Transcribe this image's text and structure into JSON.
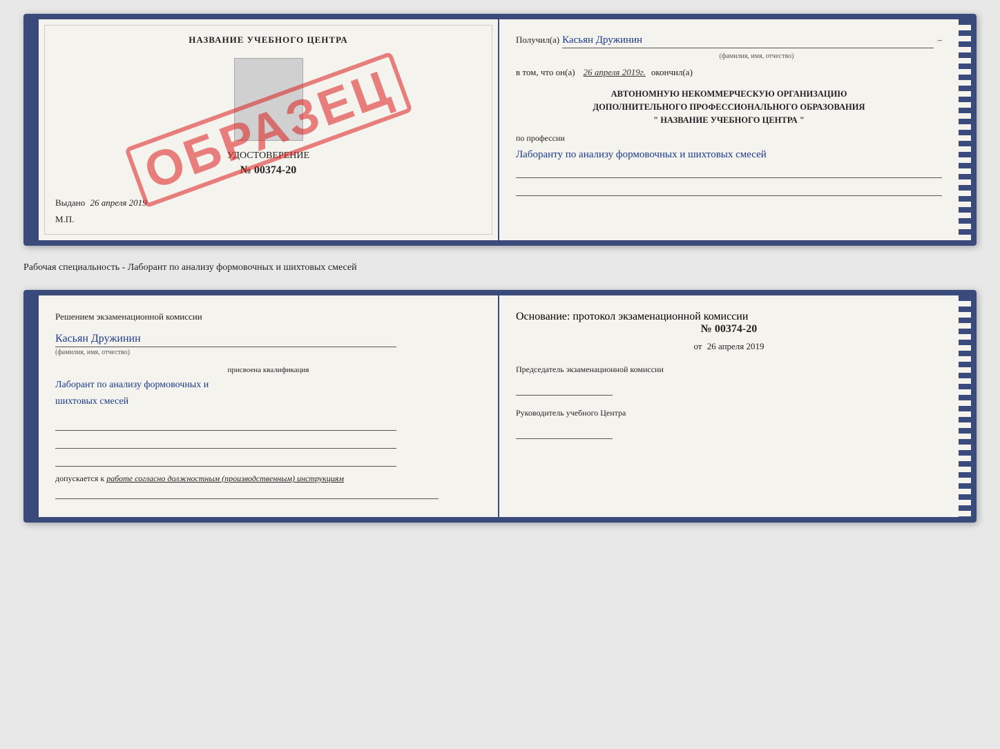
{
  "page": {
    "background": "#e8e8e8"
  },
  "top_booklet": {
    "left": {
      "title": "НАЗВАНИЕ УЧЕБНОГО ЦЕНТРА",
      "stamp": "ОБРАЗЕЦ",
      "udostoverenie_label": "УДОСТОВЕРЕНИЕ",
      "number": "№ 00374-20",
      "vydano_label": "Выдано",
      "vydano_date": "26 апреля 2019",
      "mp": "М.П."
    },
    "right": {
      "poluchil_label": "Получил(а)",
      "poluchil_name": "Касьян Дружинин",
      "fio_sub": "(фамилия, имя, отчество)",
      "vtom_label": "в том, что он(а)",
      "vtom_date": "26 апреля 2019г.",
      "okonchil_label": "окончил(а)",
      "org_line1": "АВТОНОМНУЮ НЕКОММЕРЧЕСКУЮ ОРГАНИЗАЦИЮ",
      "org_line2": "ДОПОЛНИТЕЛЬНОГО ПРОФЕССИОНАЛЬНОГО ОБРАЗОВАНИЯ",
      "org_line3": "\"  НАЗВАНИЕ УЧЕБНОГО ЦЕНТРА  \"",
      "po_professii_label": "по профессии",
      "profession_text": "Лаборанту по анализу формовочных и шихтовых смесей"
    }
  },
  "specialty_text": "Рабочая специальность - Лаборант по анализу формовочных и шихтовых смесей",
  "bottom_booklet": {
    "left": {
      "section_title": "Решением экзаменационной комиссии",
      "person_name": "Касьян Дружинин",
      "fio_sub": "(фамилия, имя, отчество)",
      "qualification_label": "присвоена квалификация",
      "qualification_text": "Лаборант по анализу формовочных и\nшихтовых смесей",
      "dopuskaetsya_label": "допускается к",
      "dopuskaetsya_text": "работе согласно должностным (производственным) инструкциям"
    },
    "right": {
      "osnovanie_label": "Основание: протокол экзаменационной комиссии",
      "protocol_number": "№ 00374-20",
      "ot_label": "от",
      "ot_date": "26 апреля 2019",
      "predsedatel_label": "Председатель экзаменационной комиссии",
      "rukovoditel_label": "Руководитель учебного Центра"
    }
  }
}
